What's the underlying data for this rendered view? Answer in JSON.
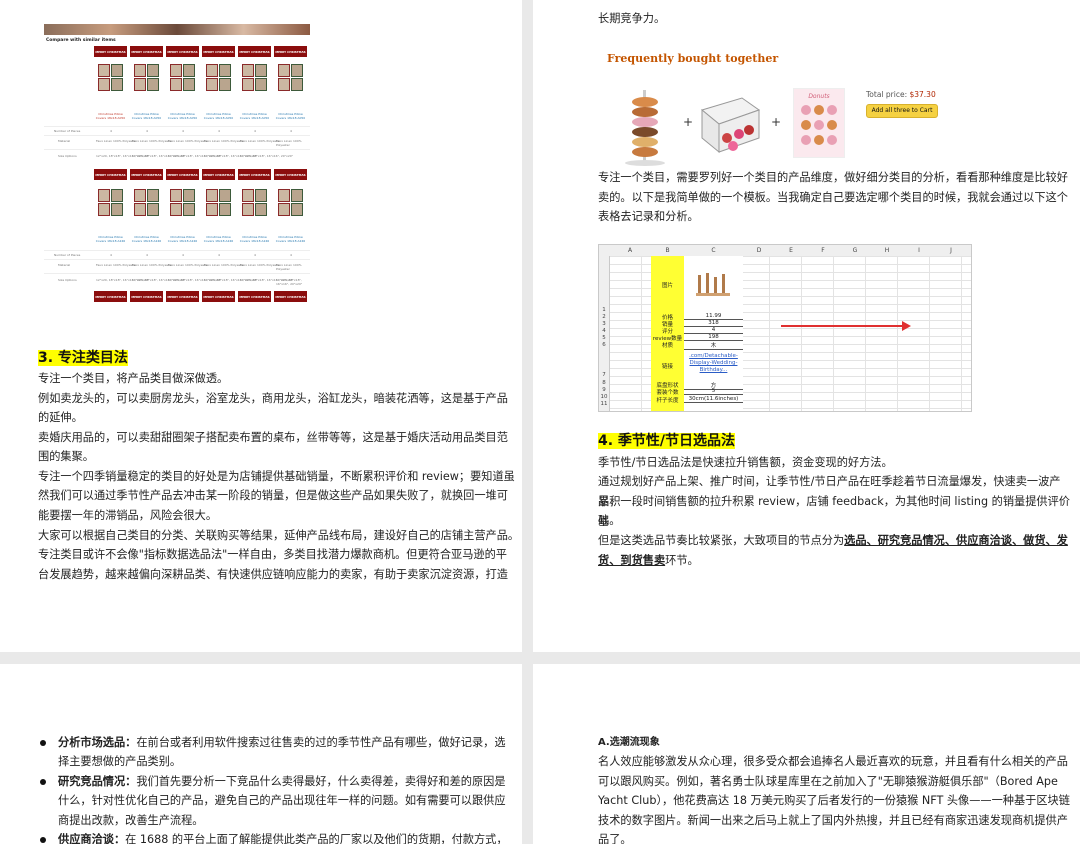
{
  "page1": {
    "table": {
      "title": "Compare with similar items",
      "banner": "MERRY CHRISTMAS",
      "item_name_1": "Christmas Pillow Covers 18x18 A050",
      "item_name_2": "Christmas Pillow Covers 18x18 A246",
      "row_pieces": "Number of Pieces",
      "row_material": "Material",
      "row_size": "Size Options",
      "value_pieces": "4",
      "value_material": "Faux Linen 100% Polyester",
      "value_size": "12\"x20, 18\"x18\", 16\"x16\", 20\"x20\""
    },
    "section3": {
      "heading": "3. 专注类目法",
      "paras": [
        "专注一个类目，将产品类目做深做透。",
        "例如卖龙头的，可以卖厨房龙头，浴室龙头，商用龙头，浴缸龙头，暗装花洒等，这是基于产品",
        "的延伸。",
        "卖婚庆用品的，可以卖甜甜圈架子搭配卖布置的桌布，丝带等等，这是基于婚庆活动用品类目范",
        "围的集聚。",
        "专注一个四季销量稳定的类目的好处是为店铺提供基础销量，不断累积评价和 review；要知道虽",
        "然我们可以通过季节性产品去冲击某一阶段的销量，但是做这些产品如果失败了，就换回一堆可",
        "能要摆一年的滞销品，风险会很大。",
        "大家可以根据自己类目的分类、关联购买等结果，延伸产品线布局，建设好自己的店铺主营产品。",
        "专注类目或许不会像\"指标数据选品法\"一样自由，多类目找潜力爆款商机。但更符合亚马逊的平",
        "台发展趋势，越来越偏向深耕品类、有快速供应链响应能力的卖家，有助于卖家沉淀资源，打造"
      ]
    }
  },
  "page2": {
    "top_line": "长期竞争力。",
    "fbt": {
      "title": "Frequently bought together",
      "total_label": "Total price:",
      "total_value": "$37.30",
      "button": "Add all three to Cart",
      "plus": "+",
      "donut_sign": "Donuts"
    },
    "para1": [
      "专注一个类目，需要罗列好一个类目的产品维度，做好细分类目的分析，看看那种维度是比较好",
      "卖的。以下是我简单做的一个模板。当我确定自己要选定哪个类目的时候，我就会通过以下这个",
      "表格去记录和分析。"
    ],
    "sheet": {
      "columns": [
        "A",
        "B",
        "C",
        "D",
        "E",
        "F",
        "G",
        "H",
        "I",
        "J"
      ],
      "rows": [
        "1",
        "2",
        "3",
        "4",
        "5",
        "6",
        "7",
        "8",
        "9",
        "10",
        "11"
      ],
      "labels": [
        "图片",
        "价格",
        "销量",
        "评分",
        "review数量",
        "材质",
        "链接",
        "底盘形状",
        "套装个数",
        "杆子长度"
      ],
      "values": [
        "11.99",
        "318",
        "4",
        "198",
        "木",
        "",
        "方",
        "5",
        "30cm(11.6inches)"
      ],
      "link_text": ".com/Detachable-Display-Wedding-Birthday..."
    },
    "section4": {
      "heading": "4. 季节性/节日选品法",
      "para1": "季节性/节日选品法是快速拉升销售额，资金变现的好方法。",
      "para2": [
        "通过规划好产品上架、推广时间，让季节性/节日产品在旺季趁着节日流量爆发，快速卖一波产品，",
        "累积一段时间销售额的拉升积累 review，店铺 feedback，为其他时间 listing 的销量提供评价基",
        "础。"
      ],
      "para3_prefix": "但是这类选品节奏比较紧张，大致项目的节点分为",
      "para3_bold": "选品、研究竞品情况、供应商洽谈、做货、发",
      "para3_bold2": "货、到货售卖",
      "para3_suffix": "环节。"
    }
  },
  "page3": {
    "bullets": [
      {
        "bold": "分析市场选品：",
        "text": "在前台或者利用软件搜索过往售卖的过的季节性产品有哪些，做好记录，选",
        "cont": "择主要想做的产品类别。"
      },
      {
        "bold": "研究竞品情况：",
        "text": "我们首先要分析一下竞品什么卖得最好，什么卖得差，卖得好和差的原因是",
        "cont": "什么，针对性优化自己的产品，避免自己的产品出现往年一样的问题。如有需要可以跟供应",
        "cont2": "商提出改款，改善生产流程。"
      },
      {
        "bold": "供应商洽谈：",
        "text": "在 1688 的平台上面了解能提供此类产品的厂家以及他们的货期，付款方式，"
      }
    ]
  },
  "page4": {
    "heading": "A.选潮流现象",
    "paras": [
      "名人效应能够激发从众心理，很多受众都会追捧名人最近喜欢的玩意，并且看有什么相关的产品",
      "可以跟风购买。例如，著名勇士队球星库里在之前加入了\"无聊猿猴游艇俱乐部\"（Bored Ape",
      "Yacht Club），他花费高达 18 万美元购买了后者发行的一份猿猴 NFT 头像——一种基于区块链",
      "技术的数字图片。新闻一出来之后马上就上了国内外热搜，并且已经有商家迅速发现商机提供产",
      "品了。"
    ]
  }
}
